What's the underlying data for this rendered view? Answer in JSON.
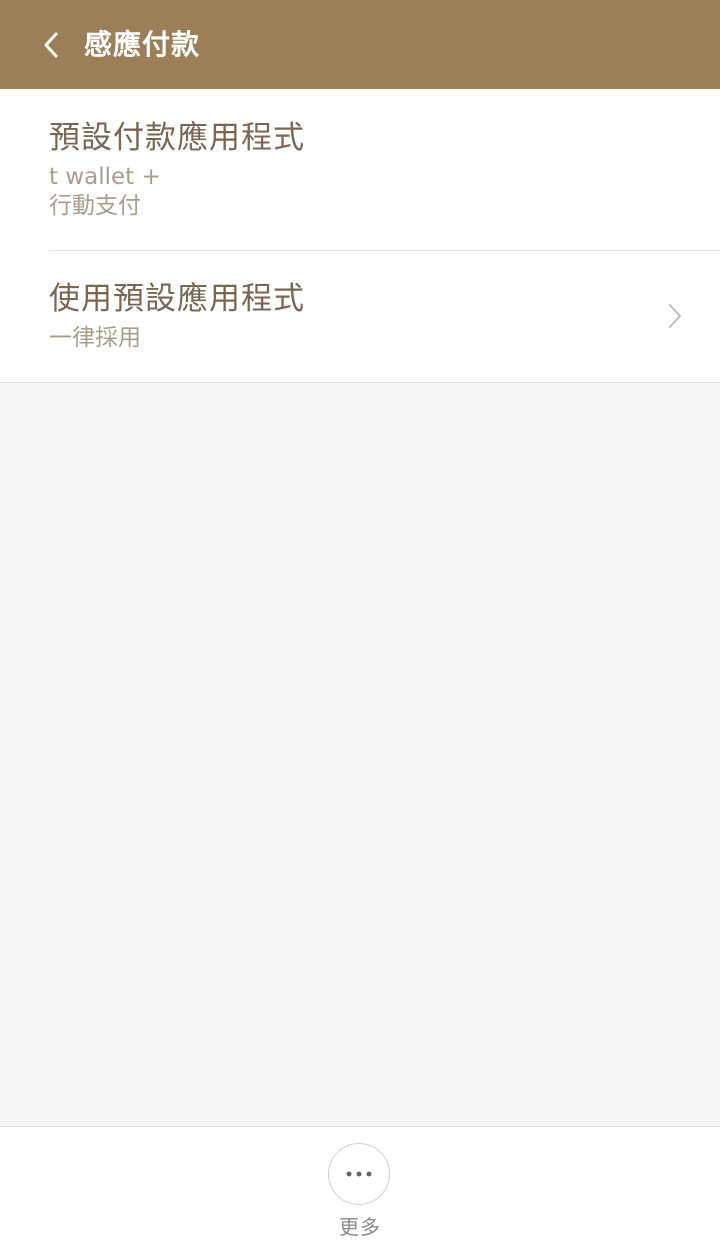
{
  "header": {
    "title": "感應付款",
    "back_icon": "chevron-left-icon",
    "background_color": "#9b7f56"
  },
  "settings": {
    "items": [
      {
        "title": "預設付款應用程式",
        "subtitle_line1": "t wallet +",
        "subtitle_line2": "行動支付"
      },
      {
        "title": "使用預設應用程式",
        "subtitle": "一律採用",
        "chevron_icon": "chevron-right-icon"
      }
    ]
  },
  "bottom_bar": {
    "more_icon": "more-dots-icon",
    "more_label": "更多"
  }
}
